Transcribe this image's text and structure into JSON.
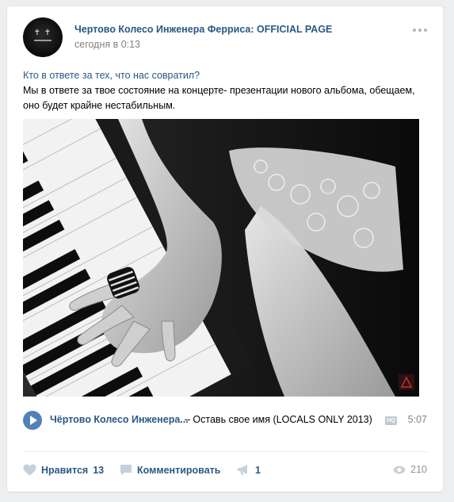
{
  "post": {
    "author": "Чертово Колесо Инженера Ферриса: OFFICIAL PAGE",
    "timestamp": "сегодня в 0:13",
    "question": "Кто в ответе за тех, что нас совратил?",
    "body": "Мы в ответе за твое состояние на концерте- презентации нового альбома, обещаем, оно будет крайне нестабильным."
  },
  "audio": {
    "artist": "Чёртово Колесо Инженера...",
    "title": "– Оставь свое имя (LOCALS ONLY 2013)",
    "quality_badge": "HQ",
    "duration": "5:07"
  },
  "actions": {
    "like_label": "Нравится",
    "like_count": "13",
    "comment_label": "Комментировать",
    "share_count": "1",
    "views_count": "210"
  },
  "icons": {
    "more": "more-dots-icon",
    "play": "play-icon",
    "like": "heart-icon",
    "comment": "comment-icon",
    "share": "megaphone-icon",
    "views": "eye-icon"
  },
  "colors": {
    "link": "#2a5885",
    "accent": "#5181b8",
    "muted": "#828282",
    "icon": "#aeb7c2"
  }
}
